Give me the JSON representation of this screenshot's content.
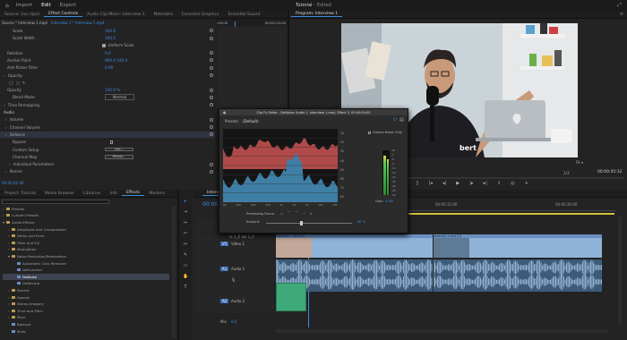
{
  "topbar": {
    "nav": [
      "Import",
      "Edit",
      "Export"
    ],
    "active": 1,
    "project": "Tutorial",
    "status": "- Edited"
  },
  "source_panel": {
    "tabs": [
      "Source: (no clips)",
      "Effect Controls",
      "Audio Clip Mixer: Interview 1",
      "Metadata",
      "Essential Graphics",
      "Essential Sound"
    ],
    "active": 1,
    "clip_header": "Source * Interview 1.mp4",
    "clip_link": "Interview 1 * Interview 1.mp4",
    "timecode_start": ":00:00",
    "timecode_end": "00:00:10:00",
    "footer_timecode": "00:00:01:40"
  },
  "effect_rows": [
    {
      "label": "Scale",
      "value": "100.0",
      "indent": 14
    },
    {
      "label": "Scale Width",
      "value": "100.0",
      "indent": 14
    },
    {
      "label": "Uniform Scale",
      "value": "",
      "indent": 14,
      "checkbox": true
    },
    {
      "label": "Rotation",
      "value": "0.0",
      "indent": 8
    },
    {
      "label": "Anchor Point",
      "value": "960.0   540.0",
      "indent": 8
    },
    {
      "label": "Anti-flicker Filter",
      "value": "0.00",
      "indent": 8
    },
    {
      "label": "Opacity",
      "value": "",
      "indent": 4,
      "section": true
    },
    {
      "label": "",
      "value": "",
      "indent": 10,
      "masks": true
    },
    {
      "label": "Opacity",
      "value": "100.0 %",
      "indent": 8
    },
    {
      "label": "Blend Mode",
      "value": "Normal",
      "indent": 14
    },
    {
      "label": "Time Remapping",
      "value": "",
      "indent": 4,
      "section": true
    },
    {
      "label": "Audio",
      "value": "",
      "indent": 1,
      "header": true
    },
    {
      "label": "Volume",
      "value": "",
      "indent": 6,
      "section": true
    },
    {
      "label": "Channel Volume",
      "value": "",
      "indent": 6,
      "section": true
    },
    {
      "label": "DeNoise",
      "value": "",
      "indent": 6,
      "section": true,
      "active": true
    },
    {
      "label": "Bypass",
      "value": "",
      "indent": 14,
      "checkbox": true
    },
    {
      "label": "Custom Setup",
      "value": "Edit...",
      "indent": 14,
      "button": true
    },
    {
      "label": "Channel Map",
      "value": "Remap...",
      "indent": 14,
      "button": true
    },
    {
      "label": "Individual Parameters",
      "value": "",
      "indent": 10,
      "section": true
    },
    {
      "label": "Panner",
      "value": "",
      "indent": 6,
      "section": true
    }
  ],
  "program": {
    "title": "Program: Interview 1",
    "timecode": "00:00:01:40",
    "fit": "Fit",
    "fraction": "1/2",
    "duration": "00:00:45:32",
    "speaker_text": "bert"
  },
  "fx_dialog": {
    "title": "Clip Fx Editor - DeNoise: Audio 1, Interview 1.mp4, Effect 3, 00:00:00:00",
    "presets_label": "Presets:",
    "preset_value": "(Default)",
    "output_noise": "Output Noise Only",
    "processing_focus": "Processing Focus:",
    "amount_label": "Amount:",
    "amount_value": "40 %",
    "gain_label": "Gain:",
    "gain_value": "0 dB",
    "db_scale": [
      "-10",
      "-20",
      "-30",
      "-40",
      "-50",
      "-60",
      "-70",
      "-80"
    ],
    "freq_scale": [
      "Hz",
      "100",
      "200",
      "500",
      "1k",
      "2k",
      "5k",
      "10k",
      "20k"
    ],
    "meter_scale": [
      "dB",
      "-3",
      "-6",
      "-9",
      "-12",
      "-18",
      "-24",
      "-30",
      "-36",
      "-48",
      "-60"
    ]
  },
  "project_panel": {
    "tabs": [
      "Project: Tutorial",
      "Media Browser",
      "Libraries",
      "Info",
      "Effects",
      "Markers"
    ],
    "active": 4,
    "items": [
      {
        "label": "Presets",
        "indent": 0,
        "type": "folder"
      },
      {
        "label": "Lumetri Presets",
        "indent": 0,
        "type": "folder"
      },
      {
        "label": "Audio Effects",
        "indent": 0,
        "type": "folder",
        "open": true
      },
      {
        "label": "Amplitude and Compression",
        "indent": 6,
        "type": "folder"
      },
      {
        "label": "Delay and Echo",
        "indent": 6,
        "type": "folder"
      },
      {
        "label": "Filter and EQ",
        "indent": 6,
        "type": "folder"
      },
      {
        "label": "Modulation",
        "indent": 6,
        "type": "folder"
      },
      {
        "label": "Noise Reduction/Restoration",
        "indent": 6,
        "type": "folder",
        "open": true
      },
      {
        "label": "Automatic Click Remover",
        "indent": 12,
        "type": "fx"
      },
      {
        "label": "DeHummer",
        "indent": 12,
        "type": "fx"
      },
      {
        "label": "DeNoise",
        "indent": 12,
        "type": "fx",
        "selected": true
      },
      {
        "label": "DeReverb",
        "indent": 12,
        "type": "fx"
      },
      {
        "label": "Reverb",
        "indent": 6,
        "type": "folder"
      },
      {
        "label": "Special",
        "indent": 6,
        "type": "folder"
      },
      {
        "label": "Stereo Imagery",
        "indent": 6,
        "type": "folder"
      },
      {
        "label": "Time and Pitch",
        "indent": 6,
        "type": "folder"
      },
      {
        "label": "Pitch",
        "indent": 6,
        "type": "folder"
      },
      {
        "label": "Balance",
        "indent": 6,
        "type": "fx"
      },
      {
        "label": "Mute",
        "indent": 6,
        "type": "fx"
      }
    ]
  },
  "timeline": {
    "tab": "Interview 1",
    "timecode": "00:00",
    "ruler": [
      "00:00",
      "00:00:15:00",
      "00:00:30:00"
    ],
    "tracks": [
      {
        "name": "V2",
        "label": ""
      },
      {
        "name": "V1",
        "label": "Video 1"
      },
      {
        "name": "A1",
        "label": "Audio 1"
      },
      {
        "name": "A2",
        "label": "Audio 2"
      },
      {
        "name": "Mix",
        "label": "Mix",
        "value": "0.0"
      }
    ],
    "clip_label_1": "Interview 1.mp4 [V]",
    "clip_label_2": "www.clip 1.mp4 [V]",
    "path_label": "fx  1_fl  Vol  1_fl"
  }
}
